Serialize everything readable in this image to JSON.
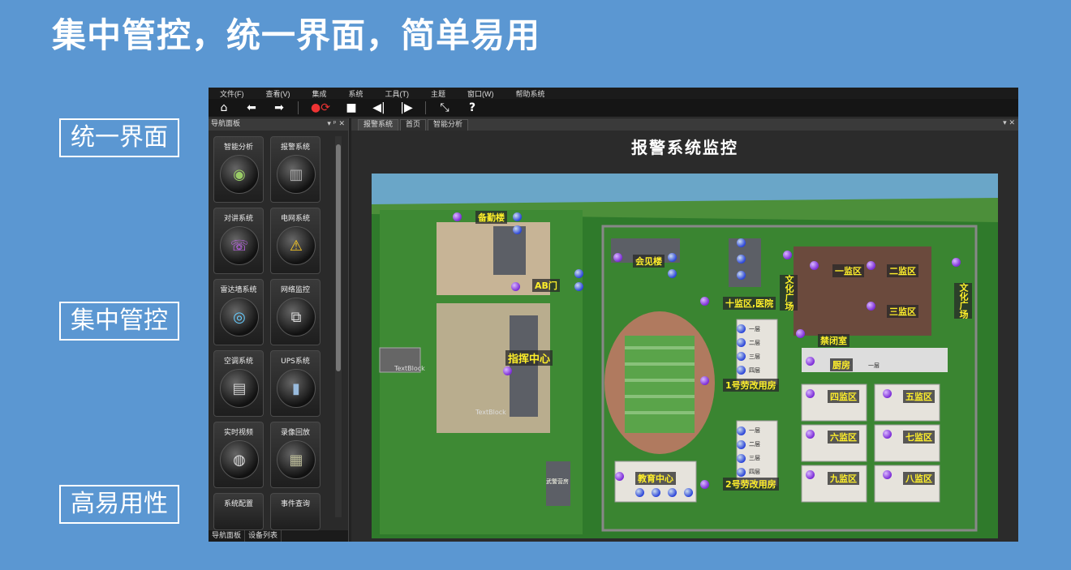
{
  "slide": {
    "title": "集中管控，统一界面，简单易用",
    "side_labels": [
      "统一界面",
      "集中管控",
      "高易用性"
    ]
  },
  "app": {
    "menu": [
      "文件(F)",
      "查看(V)",
      "集成",
      "系统",
      "工具(T)",
      "主题",
      "窗口(W)",
      "帮助系统"
    ],
    "toolbar": [
      {
        "name": "home-icon",
        "glyph": "⌂"
      },
      {
        "name": "back-icon",
        "glyph": "⬅"
      },
      {
        "name": "forward-icon",
        "glyph": "➡"
      },
      {
        "name": "alarm-refresh-icon",
        "glyph": "●⟳"
      },
      {
        "name": "stop-icon",
        "glyph": "■"
      },
      {
        "name": "step-back-icon",
        "glyph": "◀|"
      },
      {
        "name": "step-forward-icon",
        "glyph": "|▶"
      },
      {
        "name": "fullscreen-icon",
        "glyph": "⤡"
      },
      {
        "name": "help-icon",
        "glyph": "?"
      }
    ],
    "nav_panel": {
      "title": "导航面板",
      "controls": "▾ ᵖ ✕",
      "buttons": [
        {
          "label": "智能分析",
          "icon": "eye-icon",
          "glyph": "◉"
        },
        {
          "label": "报警系统",
          "icon": "server-rack-icon",
          "glyph": "▥"
        },
        {
          "label": "对讲系统",
          "icon": "phone-icon",
          "glyph": "☏"
        },
        {
          "label": "电网系统",
          "icon": "danger-sign-icon",
          "glyph": "⚠"
        },
        {
          "label": "雷达墙系统",
          "icon": "radar-icon",
          "glyph": "◎"
        },
        {
          "label": "网络监控",
          "icon": "network-icon",
          "glyph": "⧉"
        },
        {
          "label": "空调系统",
          "icon": "air-conditioner-icon",
          "glyph": "▤"
        },
        {
          "label": "UPS系统",
          "icon": "ups-icon",
          "glyph": "▮"
        },
        {
          "label": "实时视频",
          "icon": "camera-icon",
          "glyph": "◍"
        },
        {
          "label": "录像回放",
          "icon": "video-playback-icon",
          "glyph": "▦"
        },
        {
          "label": "系统配置",
          "icon": "config-icon",
          "glyph": "⚙"
        },
        {
          "label": "事件查询",
          "icon": "event-query-icon",
          "glyph": "⌕"
        }
      ],
      "bottom_tabs": [
        "导航面板",
        "设备列表"
      ]
    },
    "content": {
      "tabs": [
        "报警系统",
        "首页",
        "智能分析"
      ],
      "tab_controls": "▾ ✕",
      "title": "报警系统监控"
    },
    "map_labels": [
      "备勤楼",
      "AB门",
      "会见楼",
      "十监区,医院",
      "文化广场",
      "一监区",
      "二监区",
      "三监区",
      "文化广场",
      "禁闭室",
      "厨房",
      "指挥中心",
      "1号劳改用房",
      "四监区",
      "五监区",
      "六监区",
      "七监区",
      "教育中心",
      "2号劳改用房",
      "九监区",
      "八监区"
    ],
    "floors": [
      "一层",
      "二层",
      "三层",
      "四层"
    ],
    "text_blocks": [
      "TextBlock",
      "TextBlock"
    ],
    "small_labels": [
      "武警营房",
      "一层"
    ]
  }
}
